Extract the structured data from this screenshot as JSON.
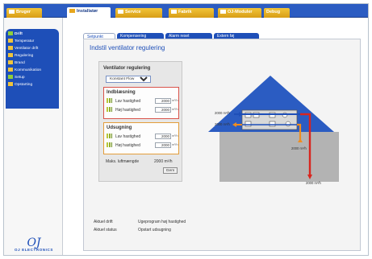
{
  "nav": {
    "tabs": [
      {
        "label": "Bruger"
      },
      {
        "label": "Installatør"
      },
      {
        "label": "Service"
      },
      {
        "label": "Fabrik"
      },
      {
        "label": "OJ-Moduler"
      },
      {
        "label": "Debug"
      }
    ],
    "active_index": 1
  },
  "sidebar": {
    "items": [
      {
        "label": "Drift"
      },
      {
        "label": "Temperatur"
      },
      {
        "label": "Ventilator drift"
      },
      {
        "label": "Regulering"
      },
      {
        "label": "Brand"
      },
      {
        "label": "Kommunikation"
      },
      {
        "label": "Setup"
      },
      {
        "label": "Opstarting"
      }
    ]
  },
  "logo": {
    "mark": "OJ",
    "text": "OJ ELECTRONICS"
  },
  "subtabs": [
    {
      "label": "Setpunkt"
    },
    {
      "label": "Kompensering"
    },
    {
      "label": "Alarm reset"
    },
    {
      "label": "Extern føj"
    }
  ],
  "page": {
    "title": "Indstil ventilator regulering"
  },
  "control": {
    "header": "Ventilator regulering",
    "mode_selected": "Konstant Flow",
    "inblowing": {
      "title": "Indblæsning",
      "low_label": "Lav hastighed",
      "low_value": "2000",
      "high_label": "Høj hastighed",
      "high_value": "2000",
      "unit": "m³/h"
    },
    "exhaust": {
      "title": "Udsugning",
      "low_label": "Lav hastighed",
      "low_value": "2000",
      "high_label": "Høj hastighed",
      "high_value": "2000",
      "unit": "m³/h"
    },
    "max_label": "Maks. luftmængde",
    "max_value": "2000 m³/h",
    "save_label": "Gem"
  },
  "diagram": {
    "flow_in_left": "2000 m³/h",
    "flow_out_left": "2000 m³/h",
    "flow_out_right_orange": "2000 m³/h",
    "flow_out_right_red": "2000 m³/h"
  },
  "status": {
    "operation_label": "Aktuel drift",
    "operation_value": "Ugeprogram høj hastighed",
    "status_label": "Aktuel status",
    "status_value": "Opstart udsugning"
  },
  "colors": {
    "nav_blue": "#2b5cc2",
    "accent_yellow": "#f0c43a",
    "roof_blue": "#2b5cc2",
    "supply_red": "#d9251e",
    "exhaust_orange": "#f08c1e",
    "intake_blue": "#1e4fb8"
  }
}
